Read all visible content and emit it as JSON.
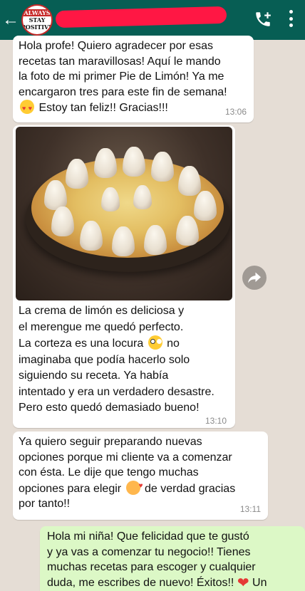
{
  "header": {
    "back_icon": "arrow-left-icon",
    "avatar_lines": [
      "ALWAYS",
      "STAY",
      "POSITIVE"
    ],
    "icons": [
      "add-call-icon",
      "more-vert-icon"
    ],
    "accent": "#075e54"
  },
  "messages": [
    {
      "direction": "in",
      "lines": [
        "Hola profe! Quiero agradecer por esas",
        "recetas tan maravillosas! Aquí le mando",
        "la foto de mi primer Pie de Limón! Ya me",
        "encargaron tres para este fin de semana!"
      ],
      "last_line": "Estoy tan feliz!! Gracias!!!",
      "time": "13:06"
    },
    {
      "direction": "in",
      "has_photo": true,
      "lines": [
        "La crema de limón es deliciosa y",
        "el merengue me quedó perfecto.",
        "La corteza es una locura",
        "no",
        "imaginaba que podía hacerlo solo",
        "siguiendo su receta. Ya había",
        "intentado y era un verdadero desastre.",
        "Pero esto quedó demasiado bueno!"
      ],
      "time": "13:10"
    },
    {
      "direction": "in",
      "lines": [
        "Ya quiero seguir preparando nuevas",
        "opciones porque mi cliente va a comenzar",
        "con ésta. Le dije que tengo muchas",
        "opciones para elegir",
        "de verdad gracias",
        "por tanto!!"
      ],
      "time": "13:11"
    },
    {
      "direction": "out",
      "lines": [
        "Hola mi niña! Que felicidad que te gustó",
        "y ya vas a comenzar tu negocio!! Tienes",
        "muchas recetas para escoger y cualquier",
        "duda, me escribes de nuevo! Éxitos!!",
        "Un"
      ],
      "bubble_color": "#dcf8c6"
    }
  ]
}
